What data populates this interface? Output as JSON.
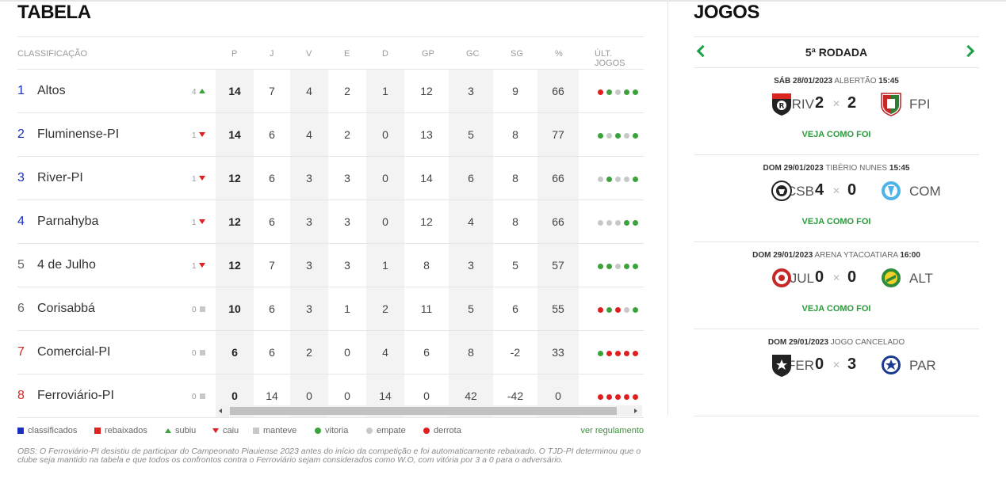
{
  "table": {
    "title": "TABELA",
    "headers": {
      "classificacao": "CLASSIFICAÇÃO",
      "p": "P",
      "j": "J",
      "v": "V",
      "e": "E",
      "d": "D",
      "gp": "GP",
      "gc": "GC",
      "sg": "SG",
      "pct": "%",
      "ult": "ÚLT. JOGOS"
    },
    "rows": [
      {
        "pos": "1",
        "team": "Altos",
        "var": "4",
        "trend": "up",
        "p": "14",
        "j": "7",
        "v": "4",
        "e": "2",
        "d": "1",
        "gp": "12",
        "gc": "3",
        "sg": "9",
        "pct": "66",
        "last": [
          "d",
          "v",
          "e",
          "v",
          "v"
        ],
        "zone": "classified"
      },
      {
        "pos": "2",
        "team": "Fluminense-PI",
        "var": "1",
        "trend": "down",
        "p": "14",
        "j": "6",
        "v": "4",
        "e": "2",
        "d": "0",
        "gp": "13",
        "gc": "5",
        "sg": "8",
        "pct": "77",
        "last": [
          "v",
          "e",
          "v",
          "e",
          "v"
        ],
        "zone": "classified"
      },
      {
        "pos": "3",
        "team": "River-PI",
        "var": "1",
        "trend": "down",
        "p": "12",
        "j": "6",
        "v": "3",
        "e": "3",
        "d": "0",
        "gp": "14",
        "gc": "6",
        "sg": "8",
        "pct": "66",
        "last": [
          "e",
          "v",
          "e",
          "e",
          "v"
        ],
        "zone": "classified"
      },
      {
        "pos": "4",
        "team": "Parnahyba",
        "var": "1",
        "trend": "down",
        "p": "12",
        "j": "6",
        "v": "3",
        "e": "3",
        "d": "0",
        "gp": "12",
        "gc": "4",
        "sg": "8",
        "pct": "66",
        "last": [
          "e",
          "e",
          "e",
          "v",
          "v"
        ],
        "zone": "classified"
      },
      {
        "pos": "5",
        "team": "4 de Julho",
        "var": "1",
        "trend": "down",
        "p": "12",
        "j": "7",
        "v": "3",
        "e": "3",
        "d": "1",
        "gp": "8",
        "gc": "3",
        "sg": "5",
        "pct": "57",
        "last": [
          "v",
          "v",
          "e",
          "v",
          "v"
        ],
        "zone": "none"
      },
      {
        "pos": "6",
        "team": "Corisabbá",
        "var": "0",
        "trend": "same",
        "p": "10",
        "j": "6",
        "v": "3",
        "e": "1",
        "d": "2",
        "gp": "11",
        "gc": "5",
        "sg": "6",
        "pct": "55",
        "last": [
          "d",
          "v",
          "d",
          "e",
          "v"
        ],
        "zone": "none"
      },
      {
        "pos": "7",
        "team": "Comercial-PI",
        "var": "0",
        "trend": "same",
        "p": "6",
        "j": "6",
        "v": "2",
        "e": "0",
        "d": "4",
        "gp": "6",
        "gc": "8",
        "sg": "-2",
        "pct": "33",
        "last": [
          "v",
          "d",
          "d",
          "d",
          "d"
        ],
        "zone": "relegated"
      },
      {
        "pos": "8",
        "team": "Ferroviário-PI",
        "var": "0",
        "trend": "same",
        "p": "0",
        "j": "14",
        "v": "0",
        "e": "0",
        "d": "14",
        "gp": "0",
        "gc": "42",
        "sg": "-42",
        "pct": "0",
        "last": [
          "d",
          "d",
          "d",
          "d",
          "d"
        ],
        "zone": "relegated"
      }
    ]
  },
  "legend": {
    "classificados": "classificados",
    "rebaixados": "rebaixados",
    "subiu": "subiu",
    "caiu": "caiu",
    "manteve": "manteve",
    "vitoria": "vitoria",
    "empate": "empate",
    "derrota": "derrota",
    "regulamento": "ver regulamento"
  },
  "obs": "OBS: O Ferroviário-PI desistiu de participar do Campeonato Piauiense 2023 antes do início da competição e foi automaticamente rebaixado. O TJD-PI determinou que o clube seja mantido na tabela e que todos os confrontos contra o Ferroviário sejam considerados como W.O, com vitória por 3 a 0 para o adversário.",
  "jogos": {
    "title": "JOGOS",
    "round": "5ª RODADA",
    "matches": [
      {
        "date": "SÁB 28/01/2023",
        "venue": "ALBERTÃO",
        "time": "15:45",
        "home": "RIV",
        "away": "FPI",
        "sh": "2",
        "sa": "2",
        "link": "VEJA COMO FOI"
      },
      {
        "date": "DOM 29/01/2023",
        "venue": "TIBÉRIO NUNES",
        "time": "15:45",
        "home": "CSB",
        "away": "COM",
        "sh": "4",
        "sa": "0",
        "link": "VEJA COMO FOI"
      },
      {
        "date": "DOM 29/01/2023",
        "venue": "ARENA YTACOATIARA",
        "time": "16:00",
        "home": "JUL",
        "away": "ALT",
        "sh": "0",
        "sa": "0",
        "link": "VEJA COMO FOI"
      },
      {
        "date": "DOM 29/01/2023",
        "venue": "JOGO CANCELADO",
        "time": "",
        "home": "FER",
        "away": "PAR",
        "sh": "0",
        "sa": "3",
        "link": ""
      }
    ]
  },
  "colors": {
    "classified": "#1a2fbf",
    "relegated": "#d9251d",
    "win": "#3ca23c",
    "draw": "#c8c8c8",
    "loss": "#e02020",
    "accent": "#2b9b3d"
  }
}
